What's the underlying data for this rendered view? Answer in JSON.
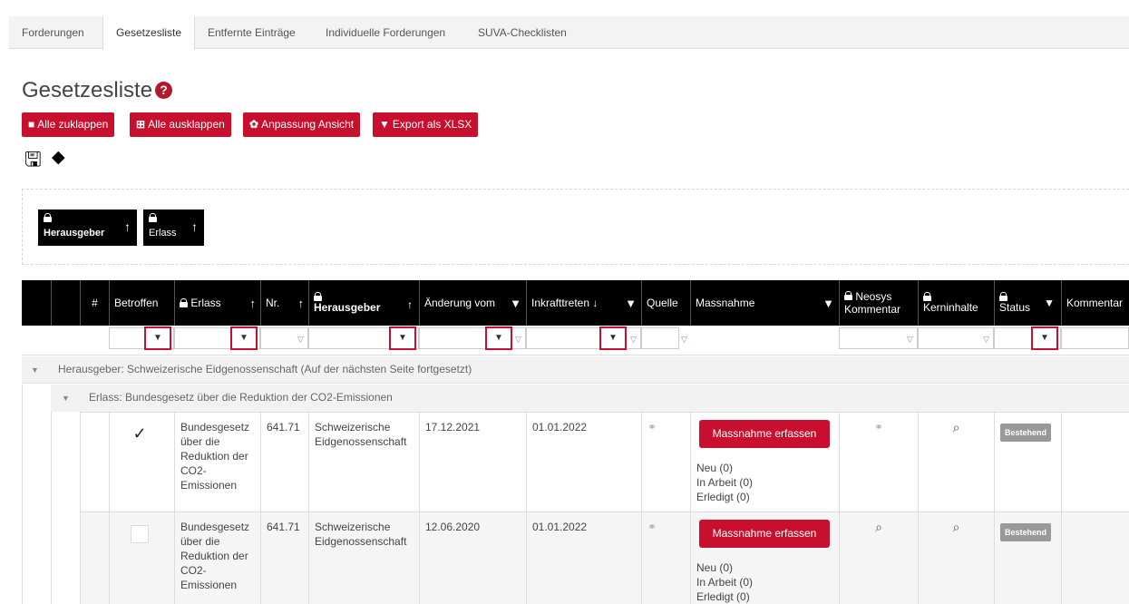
{
  "tabs": [
    "Forderungen",
    "Gesetzesliste",
    "Entfernte Einträge",
    "Individuelle Forderungen",
    "SUVA-Checklisten"
  ],
  "page_title": "Gesetzesliste",
  "help_glyph": "?",
  "buttons": {
    "collapse": "Alle zuklappen",
    "expand": "Alle ausklappen",
    "customize": "Anpassung Ansicht",
    "export": "Export als XLSX"
  },
  "group_chips": [
    {
      "label": "Herausgeber"
    },
    {
      "label": "Erlass"
    }
  ],
  "columns": {
    "hash": "#",
    "betroffen": "Betroffen",
    "erlass": "Erlass",
    "nr": "Nr.",
    "herausgeber": "Herausgeber",
    "aenderung": "Änderung vom",
    "inkraft": "Inkrafttreten",
    "quelle": "Quelle",
    "massnahme": "Massnahme",
    "neosys": "Neosys Kommentar",
    "kern": "Kerninhalte",
    "status": "Status",
    "kommentar": "Kommentar"
  },
  "groups": {
    "herausgeber": "Herausgeber: Schweizerische Eidgenossenschaft (Auf der nächsten Seite fortgesetzt)",
    "erlass": "Erlass: Bundesgesetz über die Reduktion der CO2-Emissionen"
  },
  "rows": [
    {
      "checked": "✓",
      "erlass": "Bundesgesetz über die Reduktion der CO2-Emissionen",
      "nr": "641.71",
      "herausgeber": "Schweizerische Eidgenossenschaft",
      "aenderung": "17.12.2021",
      "inkraft": "01.01.2022",
      "action": "Massnahme erfassen",
      "neu": "Neu (0)",
      "arbeit": "In Arbeit (0)",
      "erledigt": "Erledigt (0)",
      "status": "Bestehend"
    },
    {
      "checked": "",
      "erlass": "Bundesgesetz über die Reduktion der CO2-Emissionen",
      "nr": "641.71",
      "herausgeber": "Schweizerische Eidgenossenschaft",
      "aenderung": "12.06.2020",
      "inkraft": "01.01.2022",
      "action": "Massnahme erfassen",
      "neu": "Neu (0)",
      "arbeit": "In Arbeit (0)",
      "erledigt": "Erledigt (0)",
      "status": "Bestehend"
    }
  ],
  "colors": {
    "accent": "#c8102e",
    "header": "#000000"
  }
}
